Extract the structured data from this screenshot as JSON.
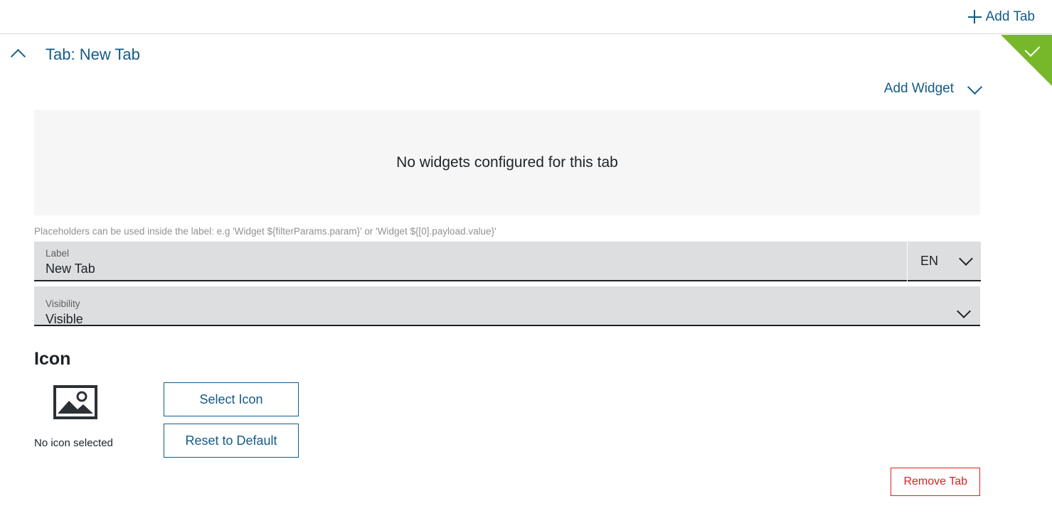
{
  "topbar": {
    "add_tab_label": "Add Tab",
    "add_tab_icon": "plus-icon"
  },
  "status_ribbon": {
    "icon": "check-icon",
    "color": "#76b82a"
  },
  "tab_header": {
    "collapse_icon": "chevron-up-icon",
    "title": "Tab: New Tab"
  },
  "widgets": {
    "add_widget_label": "Add Widget",
    "add_widget_icon": "chevron-down-icon",
    "empty_message": "No widgets configured for this tab"
  },
  "form": {
    "hint": "Placeholders can be used inside the label: e.g 'Widget ${filterParams.param}' or 'Widget ${[0].payload.value}'",
    "label_field": {
      "label": "Label",
      "value": "New Tab"
    },
    "language_field": {
      "value": "EN",
      "icon": "chevron-down-icon"
    },
    "visibility_field": {
      "label": "Visibility",
      "value": "Visible",
      "icon": "chevron-down-icon"
    }
  },
  "icon_section": {
    "heading": "Icon",
    "preview_icon": "image-placeholder-icon",
    "no_icon_text": "No icon selected",
    "select_icon_label": "Select Icon",
    "reset_default_label": "Reset to Default"
  },
  "actions": {
    "remove_tab_label": "Remove Tab"
  },
  "colors": {
    "accent_blue": "#125b8a",
    "success_green": "#76b82a",
    "danger_red": "#e02020",
    "field_bg": "#dcdee0",
    "panel_bg": "#f6f6f6"
  }
}
